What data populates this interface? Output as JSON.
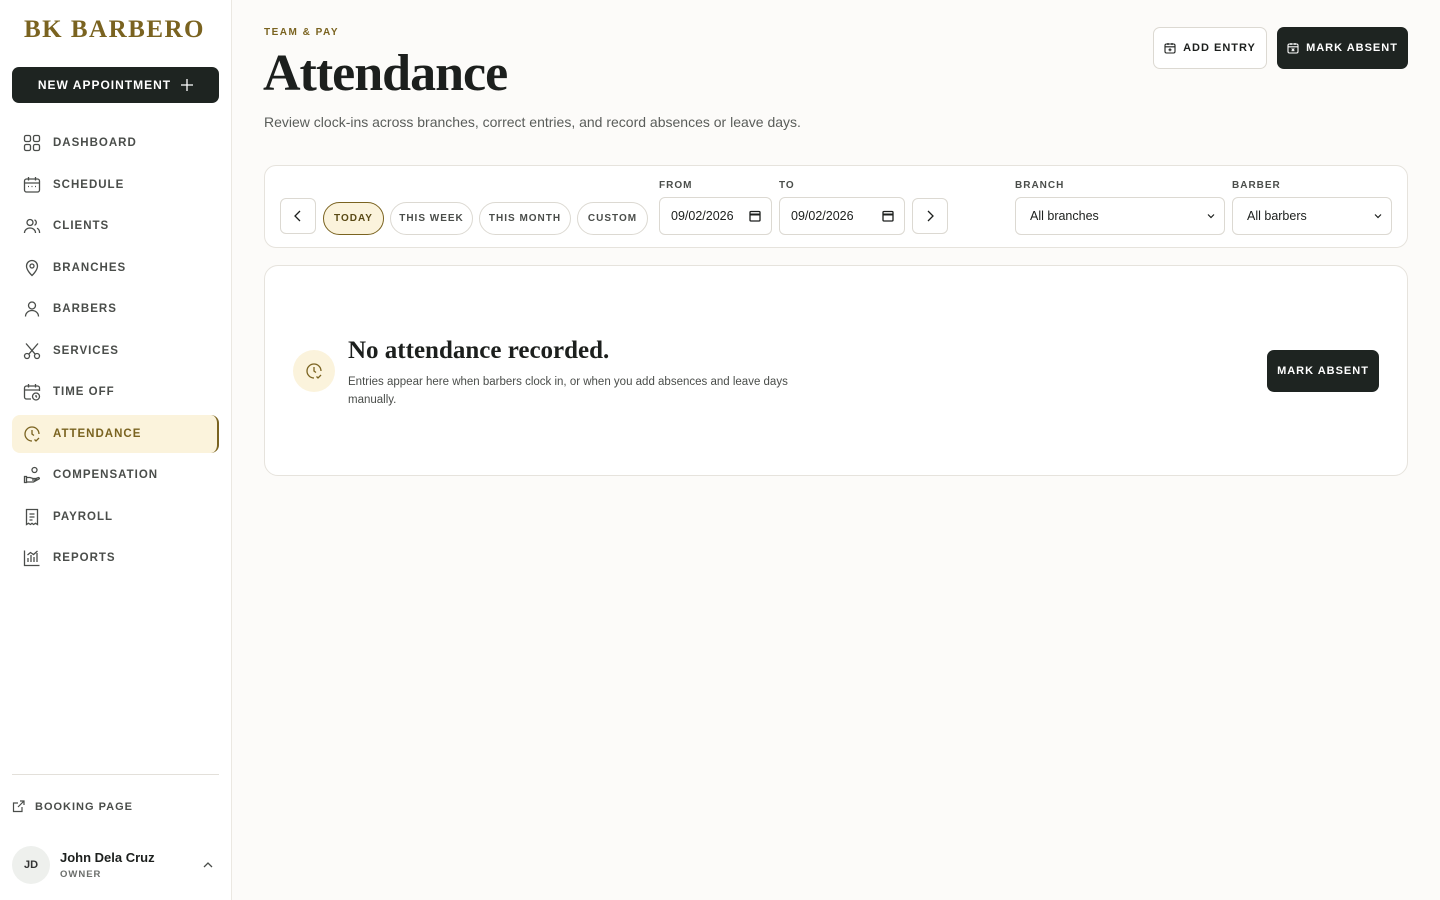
{
  "brand": "BK BARBERO",
  "sidebar": {
    "new_appointment": "NEW APPOINTMENT",
    "items": [
      {
        "label": "DASHBOARD",
        "icon": "grid-icon"
      },
      {
        "label": "SCHEDULE",
        "icon": "calendar-icon"
      },
      {
        "label": "CLIENTS",
        "icon": "users-icon"
      },
      {
        "label": "BRANCHES",
        "icon": "map-pin-icon"
      },
      {
        "label": "BARBERS",
        "icon": "user-icon"
      },
      {
        "label": "SERVICES",
        "icon": "scissors-icon"
      },
      {
        "label": "TIME OFF",
        "icon": "calendar-clock-icon"
      },
      {
        "label": "ATTENDANCE",
        "icon": "clock-check-icon"
      },
      {
        "label": "COMPENSATION",
        "icon": "hand-coins-icon"
      },
      {
        "label": "PAYROLL",
        "icon": "receipt-icon"
      },
      {
        "label": "REPORTS",
        "icon": "chart-icon"
      }
    ],
    "active": "ATTENDANCE",
    "booking_page": "BOOKING PAGE",
    "user": {
      "initials": "JD",
      "name": "John Dela Cruz",
      "role": "OWNER"
    }
  },
  "header": {
    "eyebrow": "TEAM & PAY",
    "title": "Attendance",
    "subtitle": "Review clock-ins across branches, correct entries, and record absences or leave days.",
    "add_entry": "ADD ENTRY",
    "mark_absent": "MARK ABSENT"
  },
  "filters": {
    "ranges": [
      "TODAY",
      "THIS WEEK",
      "THIS MONTH",
      "CUSTOM"
    ],
    "active_range": "TODAY",
    "from_label": "FROM",
    "from_value": "09/02/2026",
    "to_label": "TO",
    "to_value": "09/02/2026",
    "branch_label": "BRANCH",
    "branch_value": "All branches",
    "barber_label": "BARBER",
    "barber_value": "All barbers"
  },
  "empty": {
    "title": "No attendance recorded.",
    "description": "Entries appear here when barbers clock in, or when you add absences and leave days manually.",
    "button": "MARK ABSENT"
  },
  "colors": {
    "accent": "#7a6320",
    "dark": "#1e2421",
    "active_bg": "#fbf3dc"
  }
}
